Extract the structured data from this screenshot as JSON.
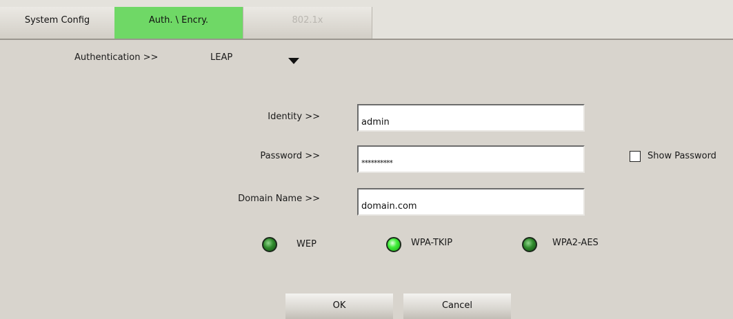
{
  "tabs": [
    {
      "label": "System Config"
    },
    {
      "label": "Auth. \\ Encry."
    },
    {
      "label": "802.1x"
    }
  ],
  "authentication": {
    "label": "Authentication >>",
    "selected": "LEAP"
  },
  "identity": {
    "label": "Identity >>",
    "value": "admin"
  },
  "password": {
    "label": "Password >>",
    "value": "**********",
    "show_label": "Show Password"
  },
  "domain": {
    "label": "Domain Name >>",
    "value": "domain.com"
  },
  "encryption": [
    {
      "label": "WEP",
      "active": false
    },
    {
      "label": "WPA-TKIP",
      "active": true
    },
    {
      "label": "WPA2-AES",
      "active": false
    }
  ],
  "buttons": {
    "ok": "OK",
    "cancel": "Cancel"
  },
  "colors": {
    "active_tab": "#6fd866",
    "background": "#d8d4cd",
    "led_on": "#41ee3a",
    "led_off": "#2f8a2c"
  }
}
